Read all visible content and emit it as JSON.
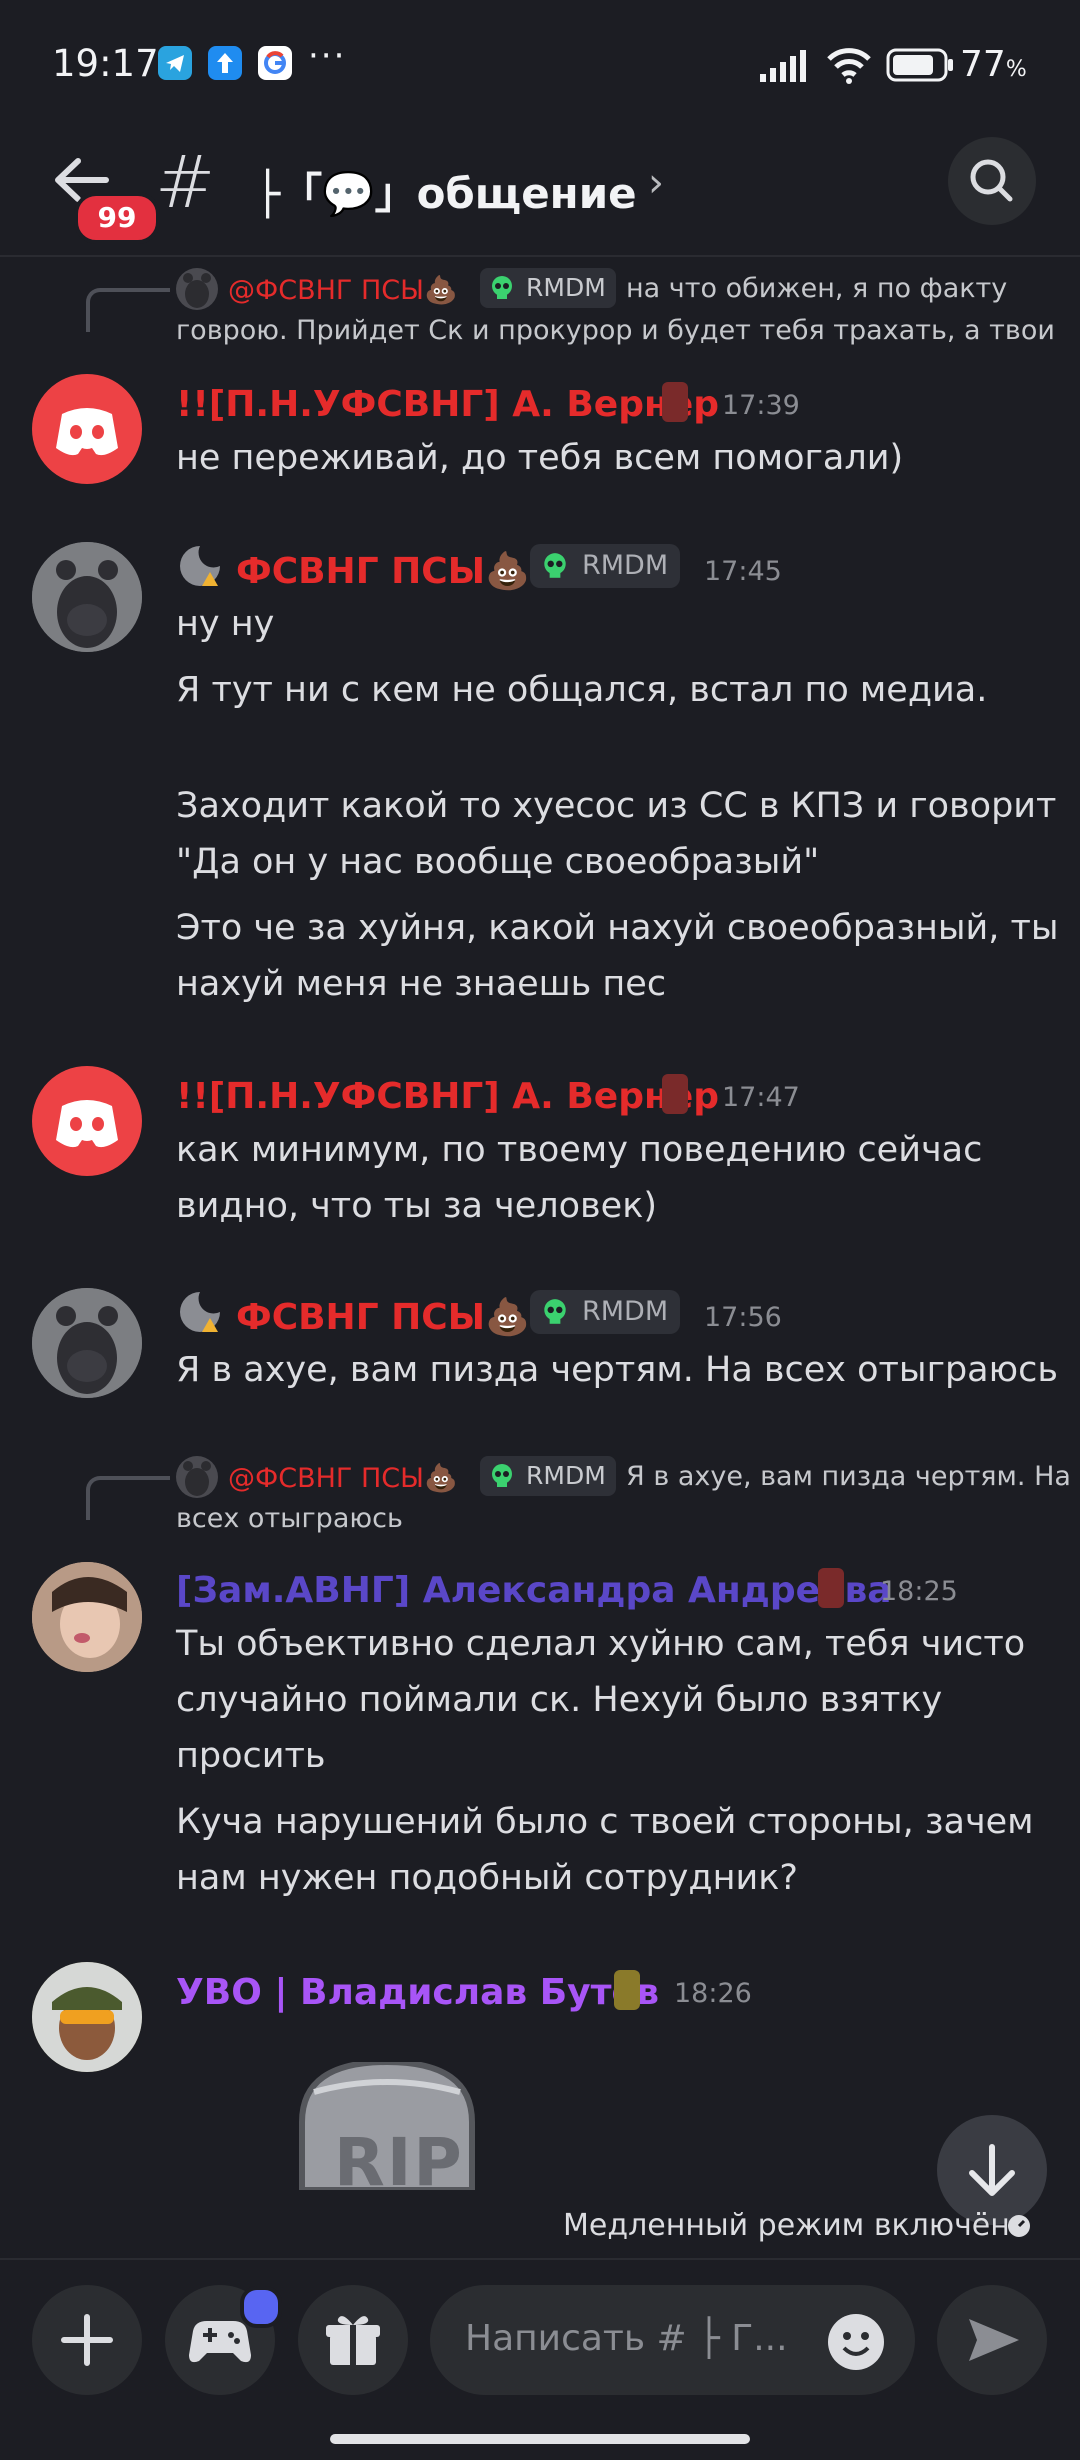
{
  "status_bar": {
    "time": "19:17",
    "apps": [
      "telegram-icon",
      "appstore-icon",
      "google-icon"
    ],
    "more": "···",
    "battery_percent": "77",
    "battery_unit": "%"
  },
  "header": {
    "unread_badge": "99",
    "channel_hash": "#",
    "channel_name": "├「💬」общение",
    "chevron": "›"
  },
  "messages": [
    {
      "reply": {
        "name": "@ФСВНГ ПСЫ💩",
        "tag": "RMDM",
        "text_line1": "на что обижен, я по факту",
        "text_line2": "говрою. Прийдет Ск и прокурор и будет тебя трахать, а твои"
      },
      "author": "!![П.Н.УФСВНГ] А. Вернер",
      "time": "17:39",
      "lines": [
        "не переживай, до тебя всем помогали)"
      ]
    },
    {
      "author": "ФСВНГ ПСЫ💩",
      "tag": "RMDM",
      "time": "17:45",
      "lines": [
        "ну ну",
        "Я тут ни с кем не общался, встал по медиа.",
        "Заходит какой то хуесос из СС в КПЗ и говорит",
        "\"Да он у нас вообще своеобразый\"",
        "Это че за хуйня, какой нахуй своеобразный, ты",
        "нахуй меня не знаешь пес"
      ]
    },
    {
      "author": "!![П.Н.УФСВНГ] А. Вернер",
      "time": "17:47",
      "lines": [
        "как минимум, по твоему поведению сейчас",
        "видно, что ты за человек)"
      ]
    },
    {
      "author": "ФСВНГ ПСЫ💩",
      "tag": "RMDM",
      "time": "17:56",
      "lines": [
        "Я в ахуе, вам пизда чертям. На всех отыграюсь"
      ]
    },
    {
      "reply": {
        "name": "@ФСВНГ ПСЫ💩",
        "tag": "RMDM",
        "text_line1": "Я в ахуе, вам пизда чертям. На",
        "text_line2": "всех отыграюсь"
      },
      "author": "[Зам.АВНГ] Александра Андреева",
      "time": "18:25",
      "lines": [
        "Ты объективно сделал хуйню сам, тебя чисто",
        "случайно поймали ск. Нехуй было взятку",
        "просить",
        "Куча нарушений было с твоей стороны, зачем",
        "нам нужен подобный сотрудник?"
      ]
    },
    {
      "author": "УВО | Владислав Бутов",
      "time": "18:26",
      "sticker_text": "RIP"
    }
  ],
  "footer": {
    "slow_mode": "Медленный режим включён.",
    "input_placeholder": "Написать # ├ Г..."
  },
  "colors": {
    "background": "#1c1d23",
    "name_red": "#e52b2b",
    "name_blue": "#5a47c8",
    "name_violet": "#a855f7",
    "discord_red": "#ed4245"
  }
}
